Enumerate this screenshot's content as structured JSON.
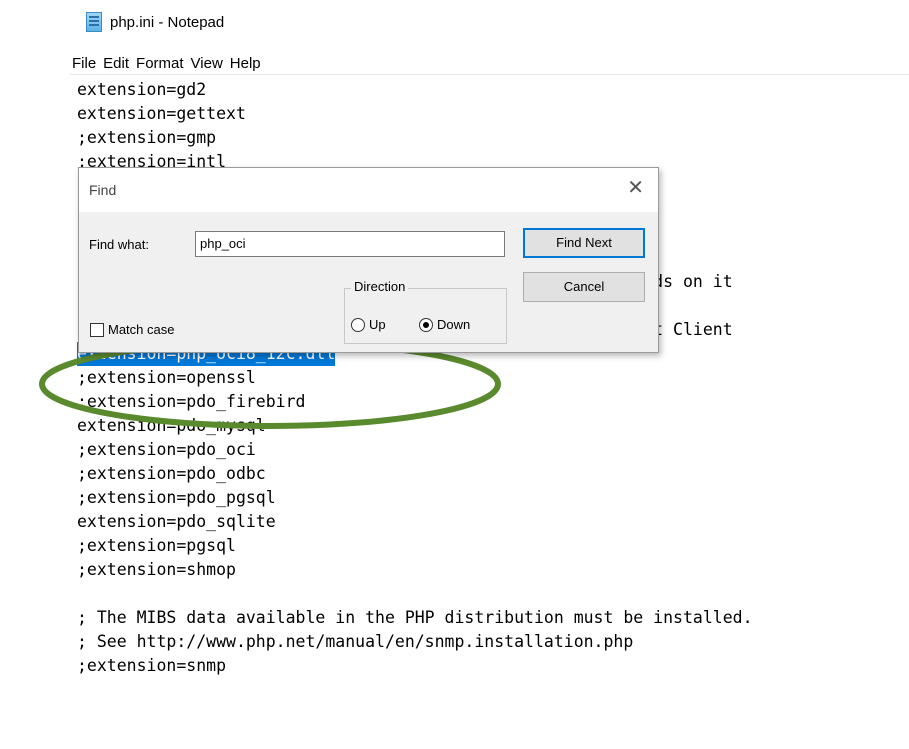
{
  "window": {
    "title": "php.ini - Notepad"
  },
  "menu": {
    "items": [
      "File",
      "Edit",
      "Format",
      "View",
      "Help"
    ]
  },
  "editor": {
    "lines": [
      "extension=gd2",
      "extension=gettext",
      ";extension=gmp",
      ";extension=intl",
      "",
      "",
      "",
      "",
      ";                                                 it depends on it",
      "",
      ";extension=oci8_12c  ; Use with Oracle Database 12c Instant Client",
      "extension=php_oci8_12c.dll",
      ";extension=openssl",
      ";extension=pdo_firebird",
      "extension=pdo_mysql",
      ";extension=pdo_oci",
      ";extension=pdo_odbc",
      ";extension=pdo_pgsql",
      "extension=pdo_sqlite",
      ";extension=pgsql",
      ";extension=shmop",
      "",
      "; The MIBS data available in the PHP distribution must be installed.",
      "; See http://www.php.net/manual/en/snmp.installation.php",
      ";extension=snmp"
    ],
    "selected_line_index": 11
  },
  "find_dialog": {
    "title": "Find",
    "close_glyph": "✕",
    "find_what_label": "Find what:",
    "find_what_value": "php_oci",
    "find_next_label": "Find Next",
    "cancel_label": "Cancel",
    "direction_label": "Direction",
    "up_label": "Up",
    "down_label": "Down",
    "direction_selected": "Down",
    "match_case_label": "Match case",
    "match_case_checked": false
  },
  "annotation": {
    "color": "#5a8a2e",
    "shape": "ellipse"
  },
  "colors": {
    "selection": "#0078d7",
    "dialog_background": "#f0f0f0"
  }
}
